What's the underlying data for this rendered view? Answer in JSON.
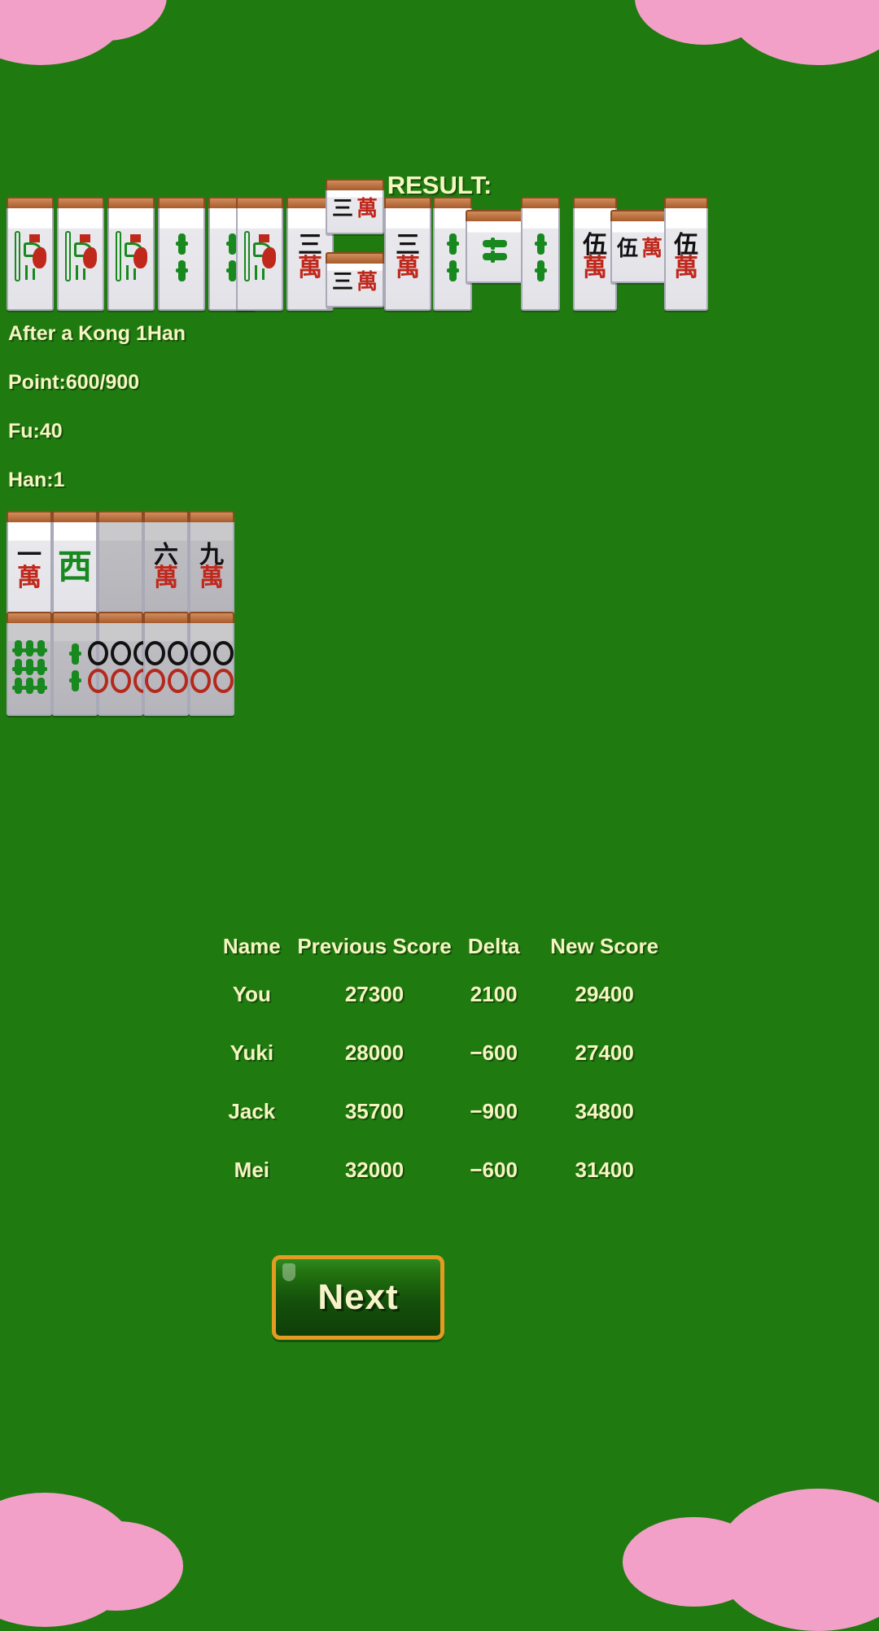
{
  "screen": {
    "title": "RESULT:",
    "background_color": "#1f7a10",
    "text_color": "#f5f5c0",
    "accent_color": "#e39b22"
  },
  "hand_info": {
    "yaku": "After a Kong 1Han",
    "point": "Point:600/900",
    "fu": "Fu:40",
    "han": "Han:1"
  },
  "winning_hand": {
    "description": "winning hand tiles displayed at top of result screen",
    "tiles": [
      {
        "suit": "bamboo",
        "value": "1",
        "label": "1 Bamboo"
      },
      {
        "suit": "bamboo",
        "value": "1",
        "label": "1 Bamboo"
      },
      {
        "suit": "bamboo",
        "value": "1",
        "label": "1 Bamboo"
      },
      {
        "suit": "bamboo",
        "value": "2",
        "label": "2 Bamboo"
      },
      {
        "suit": "bamboo",
        "value": "2",
        "label": "2 Bamboo"
      },
      {
        "suit": "bamboo",
        "value": "1",
        "label": "1 Bamboo"
      }
    ],
    "melds": [
      {
        "type": "kong",
        "suit": "character",
        "value": "3",
        "label": "3 Characters Kong"
      },
      {
        "type": "pung",
        "suit": "bamboo",
        "value": "2",
        "label": "2 Bamboo"
      },
      {
        "type": "pung",
        "suit": "character",
        "value": "5",
        "label": "5 Characters"
      }
    ]
  },
  "discards": {
    "row1": [
      {
        "label": "1 Character",
        "num": "一",
        "suit_char": "萬",
        "num_color": "#111111",
        "suit_color": "#c0281c",
        "dim": false,
        "kind": "kanji"
      },
      {
        "label": "West Wind",
        "num": "西",
        "suit_char": "",
        "num_color": "#18891e",
        "suit_color": "",
        "dim": false,
        "kind": "wind"
      },
      {
        "label": "blank tile",
        "num": "",
        "suit_char": "",
        "num_color": "",
        "suit_color": "",
        "dim": true,
        "kind": "blank"
      },
      {
        "label": "6 Characters",
        "num": "六",
        "suit_char": "萬",
        "num_color": "#111111",
        "suit_color": "#c0281c",
        "dim": true,
        "kind": "kanji"
      },
      {
        "label": "9 Characters",
        "num": "九",
        "suit_char": "萬",
        "num_color": "#111111",
        "suit_color": "#c0281c",
        "dim": true,
        "kind": "kanji"
      }
    ],
    "row2": [
      {
        "label": "9 Bamboo",
        "kind": "bamboo9",
        "dim": true
      },
      {
        "label": "2 Bamboo",
        "kind": "bamboo2",
        "dim": true
      },
      {
        "label": "6 Circles",
        "kind": "pin6",
        "dim": true
      },
      {
        "label": "4 Circles",
        "kind": "pin4",
        "dim": true
      },
      {
        "label": "4 Circles",
        "kind": "pin4",
        "dim": true
      }
    ]
  },
  "score_table": {
    "headers": [
      "Name",
      "Previous Score",
      "Delta",
      "New Score"
    ],
    "rows": [
      {
        "name": "You",
        "previous": "27300",
        "delta": "2100",
        "new": "29400"
      },
      {
        "name": "Yuki",
        "previous": "28000",
        "delta": "−600",
        "new": "27400"
      },
      {
        "name": "Jack",
        "previous": "35700",
        "delta": "−900",
        "new": "34800"
      },
      {
        "name": "Mei",
        "previous": "32000",
        "delta": "−600",
        "new": "31400"
      }
    ]
  },
  "actions": {
    "next_label": "Next"
  }
}
